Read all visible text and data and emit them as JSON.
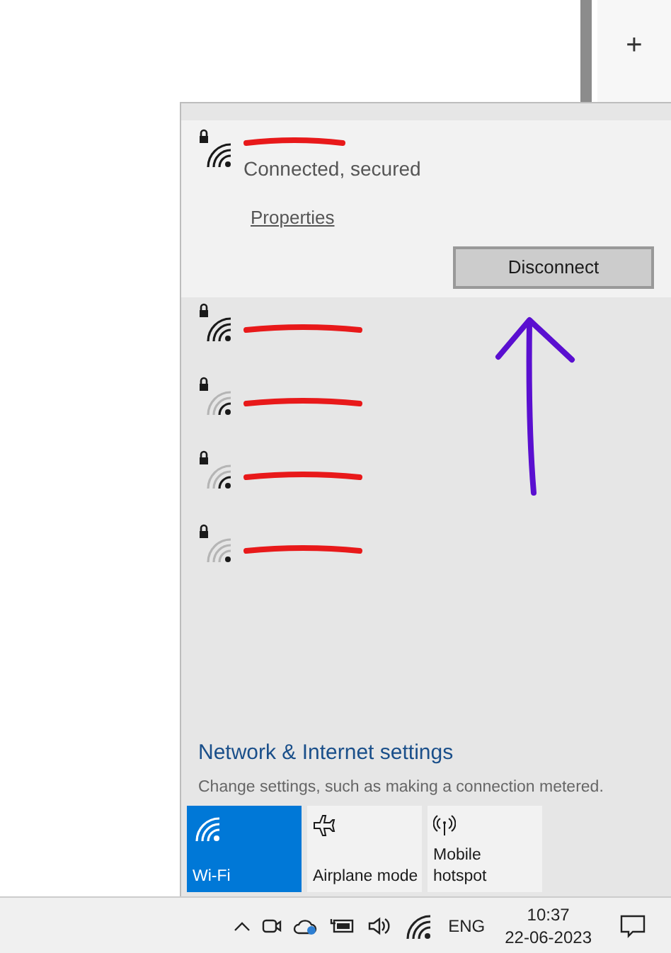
{
  "top_tab": {
    "label": "+"
  },
  "connected_network": {
    "status": "Connected, secured",
    "properties_link": "Properties",
    "disconnect_button": "Disconnect",
    "kind": "strong"
  },
  "networks": [
    {
      "kind": "strong"
    },
    {
      "kind": "weak"
    },
    {
      "kind": "weak"
    },
    {
      "kind": "weaker"
    }
  ],
  "settings_link": "Network & Internet settings",
  "settings_hint": "Change settings, such as making a connection metered.",
  "quick_actions": [
    {
      "kind": "wifi",
      "label": "Wi-Fi",
      "on": true
    },
    {
      "kind": "airplane",
      "label": "Airplane mode",
      "on": false
    },
    {
      "kind": "hotspot",
      "label": "Mobile hotspot",
      "on": false
    }
  ],
  "taskbar": {
    "language": "ENG",
    "time": "10:37",
    "date": "22-06-2023"
  }
}
